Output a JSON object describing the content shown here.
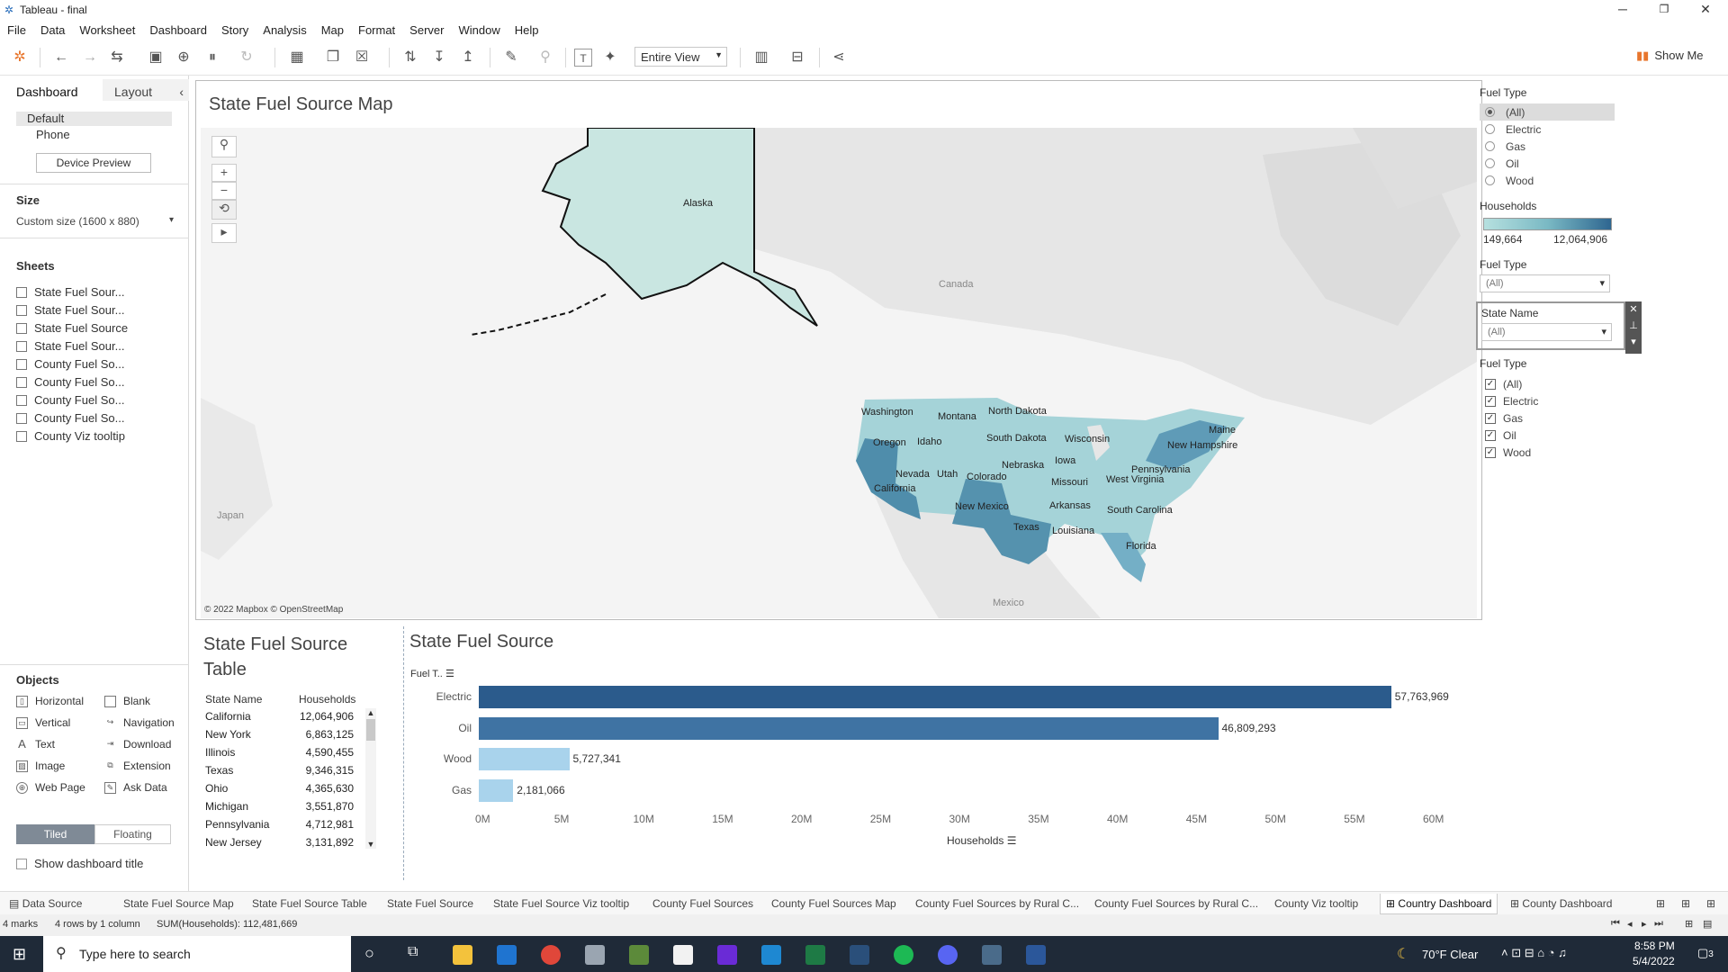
{
  "window": {
    "title": "Tableau - final",
    "min": "─",
    "max": "❐",
    "close": "✕"
  },
  "menu": [
    "File",
    "Data",
    "Worksheet",
    "Dashboard",
    "Story",
    "Analysis",
    "Map",
    "Format",
    "Server",
    "Window",
    "Help"
  ],
  "toolbar": {
    "view_select": "Entire View",
    "show_me": "Show Me"
  },
  "leftpane": {
    "tab_dashboard": "Dashboard",
    "tab_layout": "Layout",
    "device_default": "Default",
    "device_phone": "Phone",
    "device_preview": "Device Preview",
    "size_label": "Size",
    "size_value": "Custom size (1600 x 880)",
    "sheets_label": "Sheets",
    "sheets": [
      "State Fuel Sour...",
      "State Fuel Sour...",
      "State Fuel Source",
      "State Fuel Sour...",
      "County Fuel So...",
      "County Fuel So...",
      "County Fuel So...",
      "County Fuel So...",
      "County Viz tooltip"
    ],
    "objects_label": "Objects",
    "objects": [
      "Horizontal",
      "Blank",
      "Vertical",
      "Navigation",
      "Text",
      "Download",
      "Image",
      "Extension",
      "Web Page",
      "Ask Data"
    ],
    "tiled": "Tiled",
    "floating": "Floating",
    "show_title": "Show dashboard title"
  },
  "map": {
    "title": "State Fuel Source Map",
    "attribution": "© 2022 Mapbox © OpenStreetMap",
    "labels": {
      "alaska": "Alaska",
      "canada": "Canada",
      "japan": "Japan",
      "mexico": "Mexico",
      "washington": "Washington",
      "montana": "Montana",
      "north_dakota": "North Dakota",
      "oregon": "Oregon",
      "idaho": "Idaho",
      "south_dakota": "South Dakota",
      "wisconsin": "Wisconsin",
      "maine": "Maine",
      "new_hampshire": "New Hampshire",
      "iowa": "Iowa",
      "nebraska": "Nebraska",
      "pennsylvania": "Pennsylvania",
      "nevada": "Nevada",
      "utah": "Utah",
      "colorado": "Colorado",
      "missouri": "Missouri",
      "west_virginia": "West Virginia",
      "california": "California",
      "new_mexico": "New Mexico",
      "arkansas": "Arkansas",
      "south_carolina": "South Carolina",
      "texas": "Texas",
      "louisiana": "Louisiana",
      "florida": "Florida"
    }
  },
  "filters": {
    "fuel_type_title": "Fuel Type",
    "fuel_type_options": [
      "(All)",
      "Electric",
      "Gas",
      "Oil",
      "Wood"
    ],
    "households_title": "Households",
    "households_min": "149,664",
    "households_max": "12,064,906",
    "fuel_type_dd_title": "Fuel Type",
    "fuel_type_dd_value": "(All)",
    "state_name_title": "State Name",
    "state_name_value": "(All)",
    "fuel_type_cb_title": "Fuel Type",
    "fuel_type_cb_options": [
      "(All)",
      "Electric",
      "Gas",
      "Oil",
      "Wood"
    ]
  },
  "table": {
    "title_line1": "State Fuel Source",
    "title_line2": "Table",
    "col_state": "State Name",
    "col_households": "Households",
    "rows": [
      {
        "name": "California",
        "value": "12,064,906"
      },
      {
        "name": "New York",
        "value": "6,863,125"
      },
      {
        "name": "Illinois",
        "value": "4,590,455"
      },
      {
        "name": "Texas",
        "value": "9,346,315"
      },
      {
        "name": "Ohio",
        "value": "4,365,630"
      },
      {
        "name": "Michigan",
        "value": "3,551,870"
      },
      {
        "name": "Pennsylvania",
        "value": "4,712,981"
      },
      {
        "name": "New Jersey",
        "value": "3,131,892"
      }
    ]
  },
  "chart_data": {
    "type": "bar",
    "title": "State Fuel Source",
    "category_header": "Fuel T..",
    "categories": [
      "Electric",
      "Oil",
      "Wood",
      "Gas"
    ],
    "values": [
      57763969,
      46809293,
      5727341,
      2181066
    ],
    "value_labels": [
      "57,763,969",
      "46,809,293",
      "5,727,341",
      "2,181,066"
    ],
    "colors": [
      "#2b5b8c",
      "#3f73a3",
      "#a9d3ec",
      "#a9d3ec"
    ],
    "xlabel": "Households",
    "xlim": [
      0,
      60000000
    ],
    "ticks": [
      "0M",
      "5M",
      "10M",
      "15M",
      "20M",
      "25M",
      "30M",
      "35M",
      "40M",
      "45M",
      "50M",
      "55M",
      "60M"
    ]
  },
  "sheettabs": [
    "Data Source",
    "State Fuel Source Map",
    "State Fuel Source Table",
    "State Fuel Source",
    "State Fuel Source Viz tooltip",
    "County Fuel Sources",
    "County Fuel Sources Map",
    "County Fuel Sources by Rural C...",
    "County Fuel Sources by Rural C...",
    "County Viz tooltip",
    "Country Dashboard",
    "County Dashboard"
  ],
  "status": {
    "marks": "4 marks",
    "rows": "4 rows by 1 column",
    "sum": "SUM(Households): 112,481,669"
  },
  "taskbar": {
    "search": "Type here to search",
    "weather": "70°F  Clear",
    "time": "8:58 PM",
    "date": "5/4/2022",
    "notif": "3"
  }
}
